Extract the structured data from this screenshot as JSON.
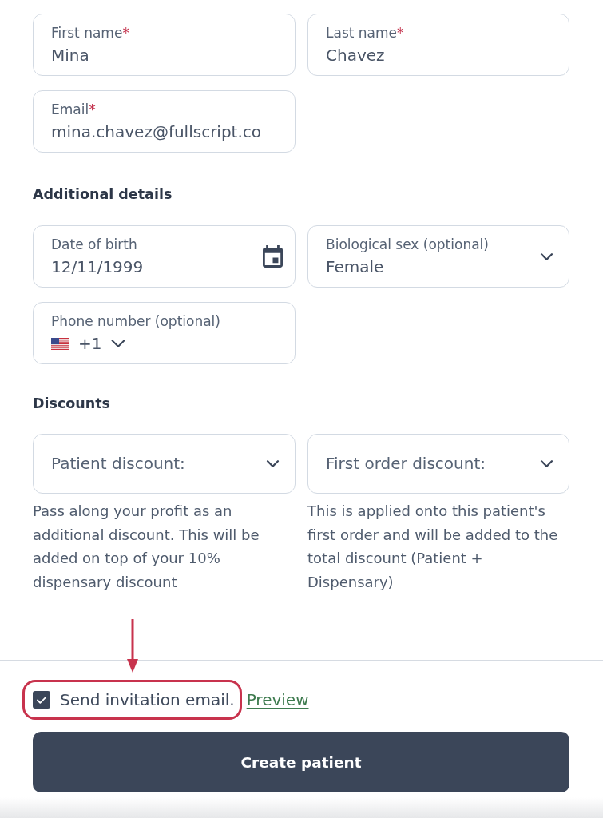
{
  "contact_fields": [
    {
      "kind": "text",
      "label": "First name",
      "required_mark": "*",
      "value": "Mina"
    },
    {
      "kind": "text",
      "label": "Last name",
      "required_mark": "*",
      "value": "Chavez"
    },
    {
      "kind": "text",
      "label": "Email",
      "required_mark": "*",
      "value": "mina.chavez@fullscript.co"
    }
  ],
  "additional_details": {
    "heading": "Additional details",
    "fields": [
      {
        "kind": "date",
        "label": "Date of birth",
        "value": "12/11/1999"
      },
      {
        "kind": "select",
        "label": "Biological sex (optional)",
        "value": "Female"
      },
      {
        "kind": "phone",
        "label": "Phone number (optional)",
        "value": "+1"
      }
    ]
  },
  "discounts": {
    "heading": "Discounts",
    "items": [
      {
        "label": "Patient discount:",
        "help": "Pass along your profit as an additional discount. This will be added on top of your 10% dispensary discount"
      },
      {
        "label": "First order discount:",
        "help": "This is applied onto this patient's first order and will be added to the total discount (Patient + Dispensary)"
      }
    ]
  },
  "invitation": {
    "checked": true,
    "label": "Send invitation email.",
    "link": "Preview"
  },
  "submit_button": "Create patient"
}
